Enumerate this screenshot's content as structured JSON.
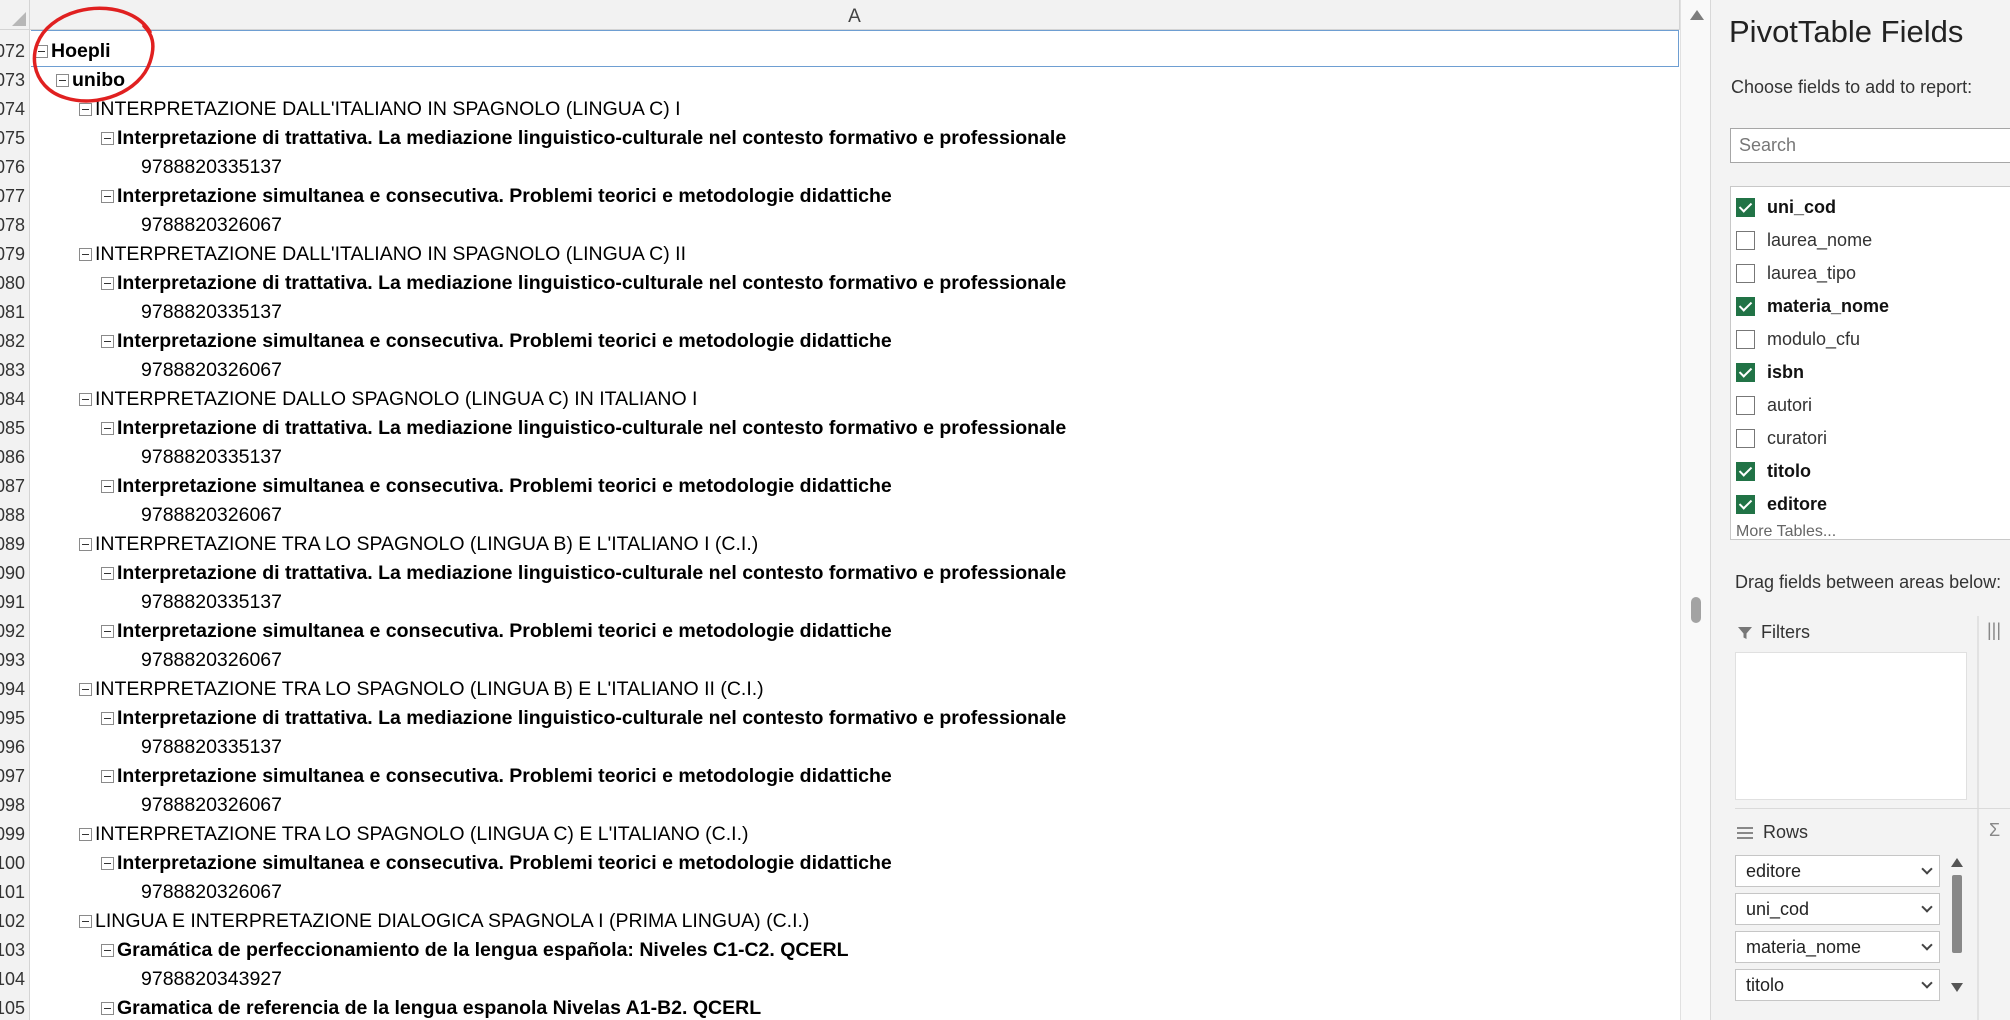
{
  "sheet": {
    "column_header": "A",
    "row_numbers": [
      "072",
      "073",
      "074",
      "075",
      "076",
      "077",
      "078",
      "079",
      "080",
      "081",
      "082",
      "083",
      "084",
      "085",
      "086",
      "087",
      "088",
      "089",
      "090",
      "091",
      "092",
      "093",
      "094",
      "095",
      "096",
      "097",
      "098",
      "099",
      "100",
      "101",
      "102",
      "103",
      "104",
      "105"
    ],
    "rows": [
      {
        "level": 0,
        "bold": true,
        "collapse": true,
        "text": "Hoepli"
      },
      {
        "level": 1,
        "bold": true,
        "collapse": true,
        "text": "unibo"
      },
      {
        "level": 2,
        "bold": false,
        "collapse": true,
        "text": "INTERPRETAZIONE DALL'ITALIANO IN SPAGNOLO (LINGUA C) I"
      },
      {
        "level": 3,
        "bold": true,
        "collapse": true,
        "text": "Interpretazione di trattativa. La mediazione linguistico-culturale nel contesto formativo e professionale"
      },
      {
        "level": 4,
        "bold": false,
        "collapse": false,
        "text": "9788820335137"
      },
      {
        "level": 3,
        "bold": true,
        "collapse": true,
        "text": "Interpretazione simultanea e consecutiva. Problemi teorici e metodologie didattiche"
      },
      {
        "level": 4,
        "bold": false,
        "collapse": false,
        "text": "9788820326067"
      },
      {
        "level": 2,
        "bold": false,
        "collapse": true,
        "text": "INTERPRETAZIONE DALL'ITALIANO IN SPAGNOLO (LINGUA C) II"
      },
      {
        "level": 3,
        "bold": true,
        "collapse": true,
        "text": "Interpretazione di trattativa. La mediazione linguistico-culturale nel contesto formativo e professionale"
      },
      {
        "level": 4,
        "bold": false,
        "collapse": false,
        "text": "9788820335137"
      },
      {
        "level": 3,
        "bold": true,
        "collapse": true,
        "text": "Interpretazione simultanea e consecutiva. Problemi teorici e metodologie didattiche"
      },
      {
        "level": 4,
        "bold": false,
        "collapse": false,
        "text": "9788820326067"
      },
      {
        "level": 2,
        "bold": false,
        "collapse": true,
        "text": "INTERPRETAZIONE DALLO SPAGNOLO (LINGUA C) IN ITALIANO I"
      },
      {
        "level": 3,
        "bold": true,
        "collapse": true,
        "text": "Interpretazione di trattativa. La mediazione linguistico-culturale nel contesto formativo e professionale"
      },
      {
        "level": 4,
        "bold": false,
        "collapse": false,
        "text": "9788820335137"
      },
      {
        "level": 3,
        "bold": true,
        "collapse": true,
        "text": "Interpretazione simultanea e consecutiva. Problemi teorici e metodologie didattiche"
      },
      {
        "level": 4,
        "bold": false,
        "collapse": false,
        "text": "9788820326067"
      },
      {
        "level": 2,
        "bold": false,
        "collapse": true,
        "text": "INTERPRETAZIONE TRA LO SPAGNOLO (LINGUA B) E L'ITALIANO I (C.I.)"
      },
      {
        "level": 3,
        "bold": true,
        "collapse": true,
        "text": "Interpretazione di trattativa. La mediazione linguistico-culturale nel contesto formativo e professionale"
      },
      {
        "level": 4,
        "bold": false,
        "collapse": false,
        "text": "9788820335137"
      },
      {
        "level": 3,
        "bold": true,
        "collapse": true,
        "text": "Interpretazione simultanea e consecutiva. Problemi teorici e metodologie didattiche"
      },
      {
        "level": 4,
        "bold": false,
        "collapse": false,
        "text": "9788820326067"
      },
      {
        "level": 2,
        "bold": false,
        "collapse": true,
        "text": "INTERPRETAZIONE TRA LO SPAGNOLO (LINGUA B) E L'ITALIANO II (C.I.)"
      },
      {
        "level": 3,
        "bold": true,
        "collapse": true,
        "text": "Interpretazione di trattativa. La mediazione linguistico-culturale nel contesto formativo e professionale"
      },
      {
        "level": 4,
        "bold": false,
        "collapse": false,
        "text": "9788820335137"
      },
      {
        "level": 3,
        "bold": true,
        "collapse": true,
        "text": "Interpretazione simultanea e consecutiva. Problemi teorici e metodologie didattiche"
      },
      {
        "level": 4,
        "bold": false,
        "collapse": false,
        "text": "9788820326067"
      },
      {
        "level": 2,
        "bold": false,
        "collapse": true,
        "text": "INTERPRETAZIONE TRA LO SPAGNOLO (LINGUA C) E L'ITALIANO (C.I.)"
      },
      {
        "level": 3,
        "bold": true,
        "collapse": true,
        "text": "Interpretazione simultanea e consecutiva. Problemi teorici e metodologie didattiche"
      },
      {
        "level": 4,
        "bold": false,
        "collapse": false,
        "text": "9788820326067"
      },
      {
        "level": 2,
        "bold": false,
        "collapse": true,
        "text": "LINGUA E INTERPRETAZIONE DIALOGICA SPAGNOLA I (PRIMA LINGUA) (C.I.)"
      },
      {
        "level": 3,
        "bold": true,
        "collapse": true,
        "text": "Gramática de perfeccionamiento de la lengua española: Niveles C1-C2. QCERL"
      },
      {
        "level": 4,
        "bold": false,
        "collapse": false,
        "text": "9788820343927"
      },
      {
        "level": 3,
        "bold": true,
        "collapse": true,
        "text": "Gramatica de referencia de la lengua espanola Nivelas A1-B2. QCERL"
      }
    ]
  },
  "pane": {
    "title": "PivotTable Fields",
    "subtitle": "Choose fields to add to report:",
    "search_placeholder": "Search",
    "fields": [
      {
        "label": "uni_cod",
        "checked": true
      },
      {
        "label": "laurea_nome",
        "checked": false
      },
      {
        "label": "laurea_tipo",
        "checked": false
      },
      {
        "label": "materia_nome",
        "checked": true
      },
      {
        "label": "modulo_cfu",
        "checked": false
      },
      {
        "label": "isbn",
        "checked": true
      },
      {
        "label": "autori",
        "checked": false
      },
      {
        "label": "curatori",
        "checked": false
      },
      {
        "label": "titolo",
        "checked": true
      },
      {
        "label": "editore",
        "checked": true
      }
    ],
    "more_tables": "More Tables...",
    "drag_label": "Drag fields between areas below:",
    "filters_label": "Filters",
    "rows_label": "Rows",
    "row_fields": [
      "editore",
      "uni_cod",
      "materia_nome",
      "titolo"
    ]
  },
  "colors": {
    "accent_green": "#217346",
    "annotation_red": "#e02020"
  },
  "icons": [
    "collapse-icon",
    "filter-icon",
    "rows-icon",
    "columns-icon",
    "sigma-icon",
    "checkbox-icon",
    "chevron-down-icon",
    "scroll-up-icon",
    "scroll-down-icon"
  ]
}
